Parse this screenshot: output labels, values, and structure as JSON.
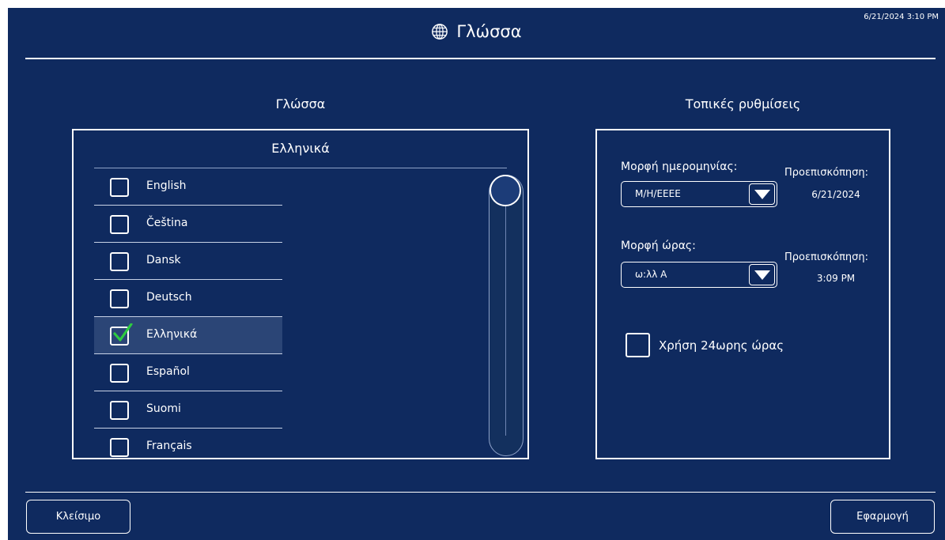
{
  "header": {
    "clock": "6/21/2024 3:10 PM",
    "title": "Γλώσσα",
    "title_icon": "globe-icon"
  },
  "language_section": {
    "heading": "Γλώσσα",
    "selected_display": "Ελληνικά",
    "items": [
      {
        "label": "English",
        "checked": false
      },
      {
        "label": "Čeština",
        "checked": false
      },
      {
        "label": "Dansk",
        "checked": false
      },
      {
        "label": "Deutsch",
        "checked": false
      },
      {
        "label": "Ελληνικά",
        "checked": true
      },
      {
        "label": "Español",
        "checked": false
      },
      {
        "label": "Suomi",
        "checked": false
      },
      {
        "label": "Français",
        "checked": false
      }
    ]
  },
  "locale_section": {
    "heading": "Τοπικές ρυθμίσεις",
    "date_format_label": "Μορφή ημερομηνίας:",
    "date_format_value": "M/H/EEEE",
    "date_preview_label": "Προεπισκόπηση:",
    "date_preview_value": "6/21/2024",
    "time_format_label": "Μορφή ώρας:",
    "time_format_value": "ω:λλ A",
    "time_preview_label": "Προεπισκόπηση:",
    "time_preview_value": "3:09 PM",
    "use_24h_label": "Χρήση 24ωρης ώρας",
    "use_24h_checked": false
  },
  "footer": {
    "close_label": "Κλείσιμο",
    "apply_label": "Εφαρμογή"
  },
  "colors": {
    "background": "#0f2a5f",
    "selected_row": "#2b4576",
    "check_green": "#2ecc40"
  }
}
